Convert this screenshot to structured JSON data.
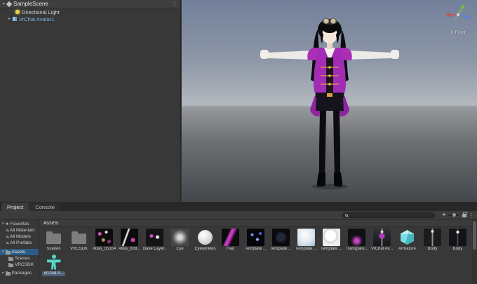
{
  "hierarchy": {
    "header": {
      "scene_name": "SampleScene"
    },
    "items": [
      {
        "label": "Directional Light"
      },
      {
        "label": "VrChat Avatar1"
      }
    ]
  },
  "scene_view": {
    "orientation_label": "X Front"
  },
  "project": {
    "tabs": [
      {
        "label": "Project"
      },
      {
        "label": "Console"
      }
    ],
    "toolbar": {
      "search_value": ""
    },
    "tree": {
      "favorites_label": "Favorites",
      "favorites": [
        "All Materials",
        "All Models",
        "All Prefabs"
      ],
      "assets_label": "Assets",
      "assets_children": [
        "Scenes",
        "VRCSDK"
      ],
      "packages_label": "Packages"
    },
    "breadcrumb": "Assets",
    "assets": [
      {
        "label": "Scenes",
        "kind": "folder"
      },
      {
        "label": "VRCSDK",
        "kind": "folder"
      },
      {
        "label": "Atlas_05164",
        "kind": "atlas"
      },
      {
        "label": "Atlas_838...",
        "kind": "atlas2"
      },
      {
        "label": "Base Layer...",
        "kind": "baselayer"
      },
      {
        "label": "Eye",
        "kind": "eye"
      },
      {
        "label": "Eyewinkles",
        "kind": "sphere-light"
      },
      {
        "label": "Hair",
        "kind": "hair"
      },
      {
        "label": "Template ...",
        "kind": "tex-sparkle"
      },
      {
        "label": "Template ...",
        "kind": "tex-dark"
      },
      {
        "label": "Template ...",
        "kind": "sphere-blue"
      },
      {
        "label": "Template ...",
        "kind": "sphere-white"
      },
      {
        "label": "Transpare...",
        "kind": "transparent-tex"
      },
      {
        "label": "VrChat Av...",
        "kind": "avatar-preview"
      },
      {
        "label": "Armature",
        "kind": "cube-teal"
      },
      {
        "label": "Body",
        "kind": "body-preview"
      },
      {
        "label": "Body",
        "kind": "body-preview2"
      }
    ],
    "selected_asset": {
      "label": "VrChat A...",
      "kind": "avatar-teal"
    }
  },
  "colors": {
    "selection_blue": "#2c5d87",
    "prefab_text_blue": "#7fb3e3",
    "avatar_jacket_magenta": "#a32cb5",
    "panel_gray": "#383838"
  }
}
